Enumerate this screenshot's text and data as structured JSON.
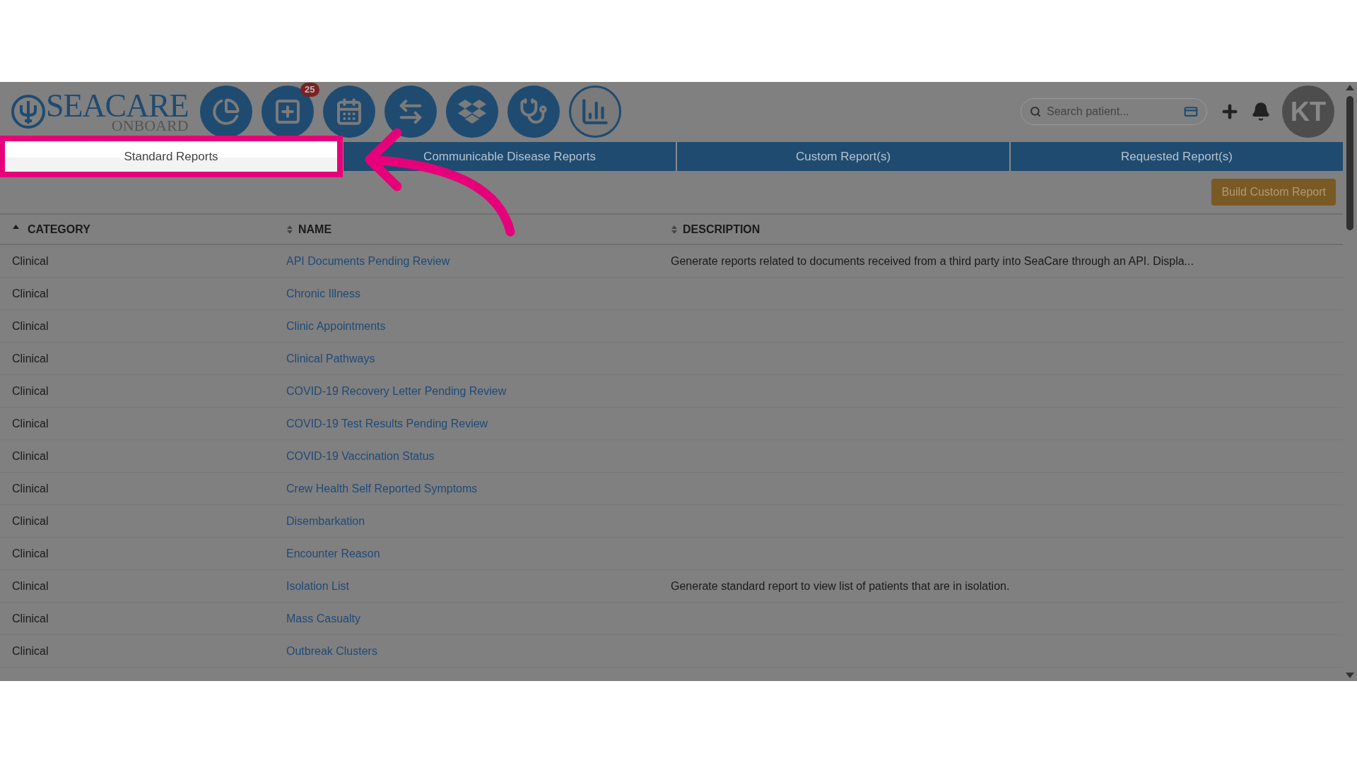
{
  "logo": {
    "main": "SEACARE",
    "sub": "ONBOARD"
  },
  "nav_buttons": [
    {
      "kind": "pie"
    },
    {
      "kind": "plus",
      "badge": "25"
    },
    {
      "kind": "calendar"
    },
    {
      "kind": "transfer"
    },
    {
      "kind": "dropbox"
    },
    {
      "kind": "stethoscope"
    },
    {
      "kind": "chart"
    }
  ],
  "search": {
    "placeholder": "Search patient..."
  },
  "avatar": "KT",
  "tabs": [
    {
      "label": "Standard Reports",
      "selected": true
    },
    {
      "label": "Communicable Disease Reports",
      "selected": false
    },
    {
      "label": "Custom Report(s)",
      "selected": false
    },
    {
      "label": "Requested Report(s)",
      "selected": false
    }
  ],
  "build_button": "Build Custom Report",
  "table": {
    "columns": [
      {
        "label": "CATEGORY",
        "sorted": true
      },
      {
        "label": "NAME",
        "sorted": false
      },
      {
        "label": "DESCRIPTION",
        "sorted": false
      }
    ],
    "rows": [
      [
        "Clinical",
        "API Documents Pending Review",
        "Generate reports related to documents received from a third party into SeaCare through an API. Displa..."
      ],
      [
        "Clinical",
        "Chronic Illness",
        ""
      ],
      [
        "Clinical",
        "Clinic Appointments",
        ""
      ],
      [
        "Clinical",
        "Clinical Pathways",
        ""
      ],
      [
        "Clinical",
        "COVID-19 Recovery Letter Pending Review",
        ""
      ],
      [
        "Clinical",
        "COVID-19 Test Results Pending Review",
        ""
      ],
      [
        "Clinical",
        "COVID-19 Vaccination Status",
        ""
      ],
      [
        "Clinical",
        "Crew Health Self Reported Symptoms",
        ""
      ],
      [
        "Clinical",
        "Disembarkation",
        ""
      ],
      [
        "Clinical",
        "Encounter Reason",
        ""
      ],
      [
        "Clinical",
        "Isolation List",
        "Generate standard report to view list of patients that are in isolation."
      ],
      [
        "Clinical",
        "Mass Casualty",
        ""
      ],
      [
        "Clinical",
        "Outbreak Clusters",
        ""
      ]
    ]
  }
}
